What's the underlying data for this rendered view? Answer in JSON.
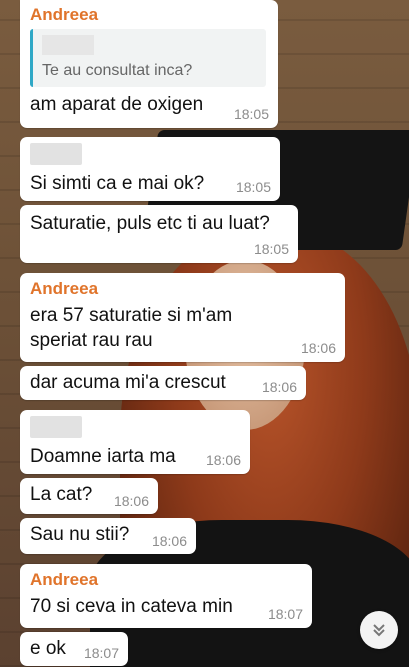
{
  "messages": [
    {
      "sender": "Andreea",
      "quote_text": "Te au consultat inca?",
      "text": "am aparat de oxigen",
      "time": "18:05"
    },
    {
      "text": "Si simti ca e mai ok?",
      "time": "18:05"
    },
    {
      "text": "Saturatie, puls etc ti au luat?",
      "time": "18:05"
    },
    {
      "sender": "Andreea",
      "text": "era 57 saturatie si m'am speriat rau rau",
      "time": "18:06"
    },
    {
      "text": "dar acuma mi'a crescut",
      "time": "18:06"
    },
    {
      "text": "Doamne iarta ma",
      "time": "18:06"
    },
    {
      "text": "La cat?",
      "time": "18:06"
    },
    {
      "text": "Sau nu stii?",
      "time": "18:06"
    },
    {
      "sender": "Andreea",
      "text": "70 si ceva in cateva min",
      "time": "18:07"
    },
    {
      "text": "e ok",
      "time": "18:07"
    }
  ],
  "scroll_button": {
    "icon": "double-chevron-down-icon"
  },
  "colors": {
    "sender": "#e0742b",
    "quote_bar": "#30a8c6",
    "bubble": "#ffffff",
    "timestamp": "#8c8c8c"
  }
}
